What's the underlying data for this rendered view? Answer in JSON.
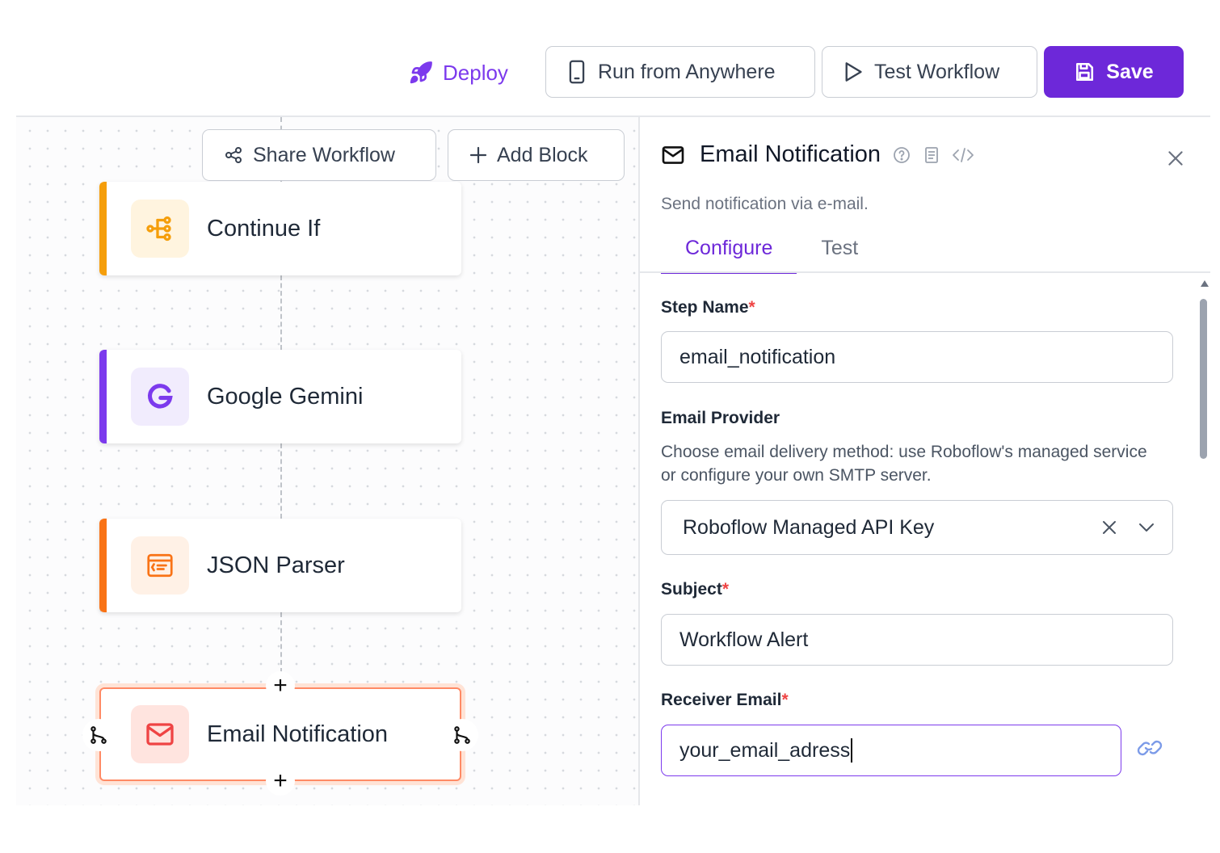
{
  "toolbar": {
    "deploy_label": "Deploy",
    "run_label": "Run from Anywhere",
    "test_label": "Test Workflow",
    "save_label": "Save"
  },
  "canvas": {
    "share_label": "Share Workflow",
    "add_block_label": "Add Block",
    "nodes": [
      {
        "label": "Continue If",
        "accent": "#f59e0b",
        "icon": "branch-icon"
      },
      {
        "label": "Google Gemini",
        "accent": "#7c3aed",
        "icon": "google-g-icon"
      },
      {
        "label": "JSON Parser",
        "accent": "#f97316",
        "icon": "json-parser-icon"
      },
      {
        "label": "Email Notification",
        "accent": "#ff8a65",
        "icon": "mail-icon"
      }
    ]
  },
  "panel": {
    "title": "Email Notification",
    "description": "Send notification via e-mail.",
    "tabs": [
      {
        "label": "Configure",
        "active": true
      },
      {
        "label": "Test",
        "active": false
      }
    ],
    "fields": {
      "step_name": {
        "label": "Step Name",
        "required_mark": "*",
        "value": "email_notification"
      },
      "email_provider": {
        "label": "Email Provider",
        "help": "Choose email delivery method: use Roboflow's managed service or configure your own SMTP server.",
        "value": "Roboflow Managed API Key"
      },
      "subject": {
        "label": "Subject",
        "required_mark": "*",
        "value": "Workflow Alert"
      },
      "receiver_email": {
        "label": "Receiver Email",
        "required_mark": "*",
        "value": "your_email_adress"
      }
    }
  },
  "colors": {
    "brand": "#6d28d9",
    "required": "#ef4444"
  }
}
